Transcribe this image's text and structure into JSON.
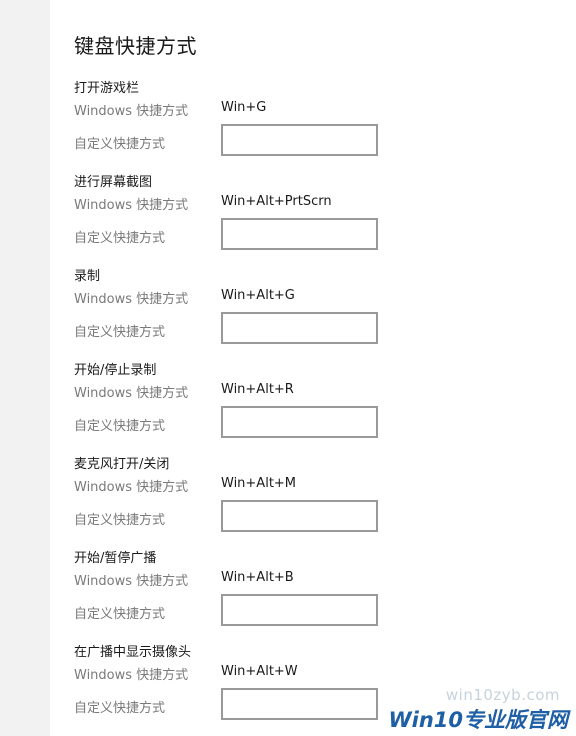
{
  "page": {
    "title": "键盘快捷方式"
  },
  "labels": {
    "windows_shortcut": "Windows 快捷方式",
    "custom_shortcut": "自定义快捷方式"
  },
  "sections": [
    {
      "title": "打开游戏栏",
      "windows_value": "Win+G",
      "custom_value": ""
    },
    {
      "title": "进行屏幕截图",
      "windows_value": "Win+Alt+PrtScrn",
      "custom_value": ""
    },
    {
      "title": "录制",
      "windows_value": "Win+Alt+G",
      "custom_value": ""
    },
    {
      "title": "开始/停止录制",
      "windows_value": "Win+Alt+R",
      "custom_value": ""
    },
    {
      "title": "麦克风打开/关闭",
      "windows_value": "Win+Alt+M",
      "custom_value": ""
    },
    {
      "title": "开始/暂停广播",
      "windows_value": "Win+Alt+B",
      "custom_value": ""
    },
    {
      "title": "在广播中显示摄像头",
      "windows_value": "Win+Alt+W",
      "custom_value": ""
    }
  ],
  "watermark": {
    "url": "win10zyb.com",
    "brand": "Win10专业版官网"
  }
}
